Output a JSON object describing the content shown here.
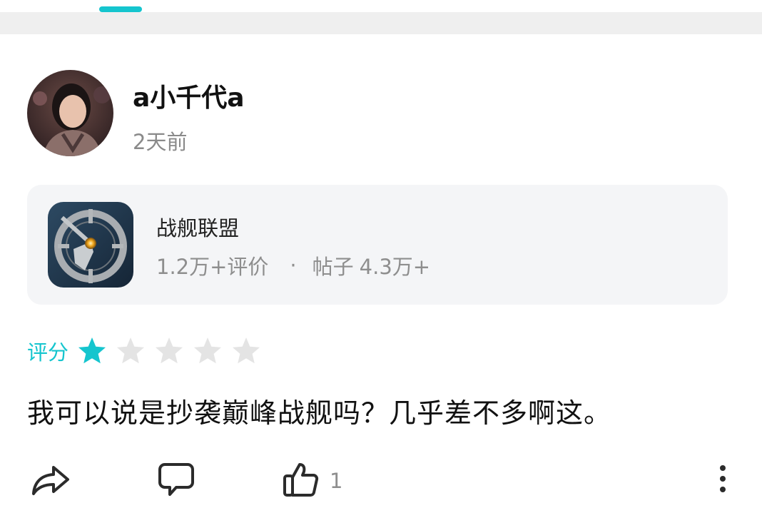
{
  "review": {
    "username": "a小千代a",
    "timestamp": "2天前",
    "rating_label": "评分",
    "rating": 1,
    "rating_max": 5,
    "text": "我可以说是抄袭巅峰战舰吗？几乎差不多啊这。",
    "like_count": "1"
  },
  "game": {
    "name": "战舰联盟",
    "reviews_count": "1.2万+评价",
    "separator": "·",
    "posts_label": "帖子",
    "posts_count": "4.3万+"
  },
  "colors": {
    "accent": "#15c5ce",
    "star_empty": "#e4e4e4",
    "card_bg": "#f4f5f7",
    "secondary_text": "#8e8e8e"
  },
  "icons": {
    "share": "share-arrow-icon",
    "comment": "comment-bubble-icon",
    "like": "thumbs-up-icon",
    "more": "more-vertical-icon"
  }
}
